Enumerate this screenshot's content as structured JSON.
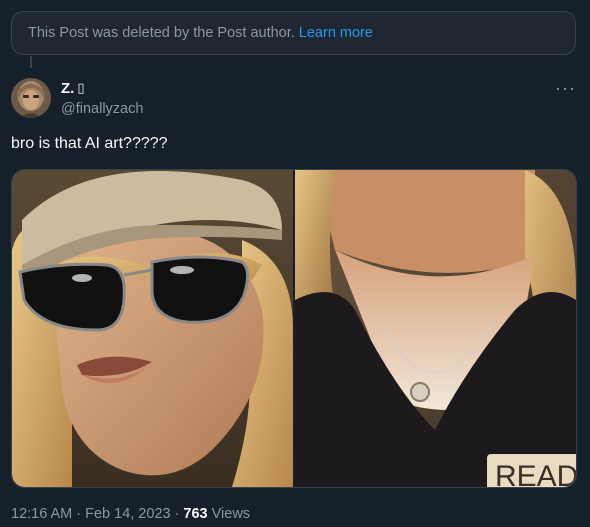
{
  "deleted_notice": {
    "text": "This Post was deleted by the Post author.",
    "link": "Learn more"
  },
  "author": {
    "name": "Z.",
    "emoji": "▯",
    "handle": "@finallyzach"
  },
  "more_icon": "more-horizontal-icon",
  "post": {
    "text": "bro is that AI art?????",
    "images": [
      {
        "name": "woman-sunglasses-cap"
      },
      {
        "name": "woman-black-jacket",
        "sign_text": "READ"
      }
    ]
  },
  "meta": {
    "time": "12:16 AM",
    "sep1": "·",
    "date": "Feb 14, 2023",
    "sep2": "·",
    "views_count": "763",
    "views_label": "Views"
  },
  "colors": {
    "background": "#15202b",
    "secondary_text": "#8b98a5",
    "link": "#1d9bf0"
  }
}
